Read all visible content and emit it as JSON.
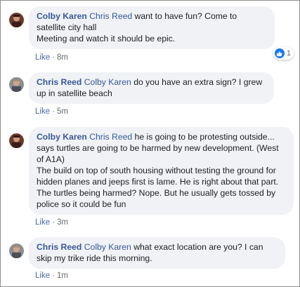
{
  "comments": [
    {
      "author": "Colby Karen",
      "mention": "Chris Reed",
      "text": " want to have fun? Come to satellite city hall\nMeeting and watch it should be epic.",
      "like_label": "Like",
      "separator": "·",
      "time": "8m",
      "reaction": {
        "icon": "like-reaction-icon",
        "count": "1"
      }
    },
    {
      "author": "Chris Reed",
      "mention": "Colby Karen",
      "text": " do you have an extra sign? I grew up in satellite beach",
      "like_label": "Like",
      "separator": "·",
      "time": "5m"
    },
    {
      "author": "Colby Karen",
      "mention": "Chris Reed",
      "text": " he is going to be protesting outside... says turtles are going to be harmed by new development. (West of A1A)\nThe build on top of south housing without testing the ground for hidden planes and jeeps first is lame. He is right about that part. The turtles being harmed? Nope. But he usually gets tossed by police so it could be fun",
      "like_label": "Like",
      "separator": "·",
      "time": "3m"
    },
    {
      "author": "Chris Reed",
      "mention": "Colby Karen",
      "text": " what exact location are you? I can skip my trike ride this morning.",
      "like_label": "Like",
      "separator": "·",
      "time": "1m"
    }
  ],
  "colors": {
    "link": "#385898",
    "bubble": "#f0f2f5",
    "like_blue": "#1877f2"
  }
}
